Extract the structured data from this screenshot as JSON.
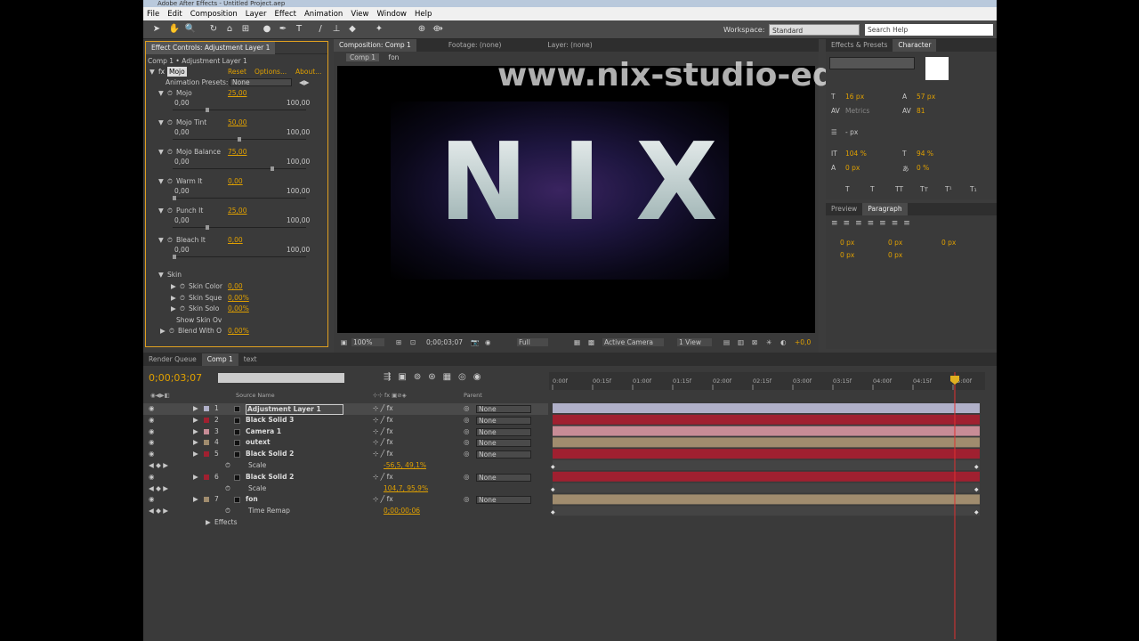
{
  "title": "Adobe After Effects - Untitled Project.aep",
  "menu": [
    "File",
    "Edit",
    "Composition",
    "Layer",
    "Effect",
    "Animation",
    "View",
    "Window",
    "Help"
  ],
  "workspace": {
    "label": "Workspace:",
    "value": "Standard"
  },
  "search_placeholder": "Search Help",
  "effect_controls": {
    "tab": "Effect Controls: Adjustment Layer 1",
    "path": "Comp 1 • Adjustment Layer 1",
    "fx_name": "Mojo",
    "reset": "Reset",
    "options": "Options...",
    "about": "About...",
    "preset_label": "Animation Presets:",
    "preset_value": "None",
    "params": [
      {
        "name": "Mojo",
        "value": "25,00",
        "min": "0,00",
        "max": "100,00",
        "level": 0.25
      },
      {
        "name": "Mojo Tint",
        "value": "50,00",
        "min": "0,00",
        "max": "100,00",
        "level": 0.5
      },
      {
        "name": "Mojo Balance",
        "value": "75,00",
        "min": "0,00",
        "max": "100,00",
        "level": 0.75
      },
      {
        "name": "Warm It",
        "value": "0,00",
        "min": "0,00",
        "max": "100,00",
        "level": 0
      },
      {
        "name": "Punch It",
        "value": "25,00",
        "min": "0,00",
        "max": "100,00",
        "level": 0.25
      },
      {
        "name": "Bleach It",
        "value": "0,00",
        "min": "0,00",
        "max": "100,00",
        "level": 0
      }
    ],
    "skin": "Skin",
    "skin_params": [
      {
        "name": "Skin Color",
        "value": "0,00"
      },
      {
        "name": "Skin Sque",
        "value": "0,00%"
      },
      {
        "name": "Skin Solo",
        "value": "0,00%"
      },
      {
        "name": "Show Skin Ov",
        "value": ""
      }
    ],
    "blend": {
      "name": "Blend With O",
      "value": "0,00%"
    }
  },
  "composition": {
    "tab": "Composition: Comp 1",
    "footage_tab": "Footage: (none)",
    "layer_tab": "Layer: (none)",
    "crumbs": [
      "Comp 1",
      "fon"
    ],
    "text": "NIX",
    "watermark": "www.nix-studio-edition.ru",
    "zoom": "100%",
    "timecode": "0;00;03;07",
    "resolution": "Full",
    "camera": "Active Camera",
    "view": "1 View",
    "exposure": "+0,0"
  },
  "right_panel": {
    "tabs": [
      "Effects & Presets",
      "Character"
    ],
    "font_size": "16 px",
    "leading": "57 px",
    "tracking_label": "Metrics",
    "tracking": "81",
    "stroke": "- px",
    "vscale": "104 %",
    "hscale": "94 %",
    "baseline": "0 px",
    "tsume": "0 %",
    "styles": [
      "T",
      "T",
      "TT",
      "Tт",
      "T¹",
      "T₁"
    ]
  },
  "paragraph": {
    "tabs": [
      "Preview",
      "Paragraph"
    ],
    "values": [
      "0 px",
      "0 px",
      "0 px",
      "0 px",
      "0 px"
    ]
  },
  "timeline": {
    "tabs": [
      "Render Queue",
      "Comp 1",
      "text"
    ],
    "timecode": "0;00;03;07",
    "col_source": "Source Name",
    "col_parent": "Parent",
    "ticks": [
      "0:00f",
      "00:15f",
      "01:00f",
      "01:15f",
      "02:00f",
      "02:15f",
      "03:00f",
      "03:15f",
      "04:00f",
      "04:15f",
      "05:00f"
    ],
    "layers": [
      {
        "num": "1",
        "name": "Adjustment Layer 1",
        "parent": "None",
        "color": "#b0b0c8"
      },
      {
        "num": "2",
        "name": "Black Solid 3",
        "parent": "None",
        "color": "#a02030"
      },
      {
        "num": "3",
        "name": "Camera 1",
        "parent": "None",
        "color": "#c88c96"
      },
      {
        "num": "4",
        "name": "outext",
        "parent": "None",
        "color": "#a08c6e"
      },
      {
        "num": "5",
        "name": "Black Solid 2",
        "parent": "None",
        "color": "#a02030"
      }
    ],
    "scale1": {
      "label": "Scale",
      "value": "-56,5, 49,1%"
    },
    "layer6": {
      "num": "6",
      "name": "Black Solid 2",
      "parent": "None",
      "color": "#a02030"
    },
    "scale2": {
      "label": "Scale",
      "value": "104,7, 95,9%"
    },
    "layer7": {
      "num": "7",
      "name": "fon",
      "parent": "None",
      "color": "#a08c6e"
    },
    "time_remap": {
      "label": "Time Remap",
      "value": "0;00;00;06"
    },
    "effects": "Effects"
  }
}
